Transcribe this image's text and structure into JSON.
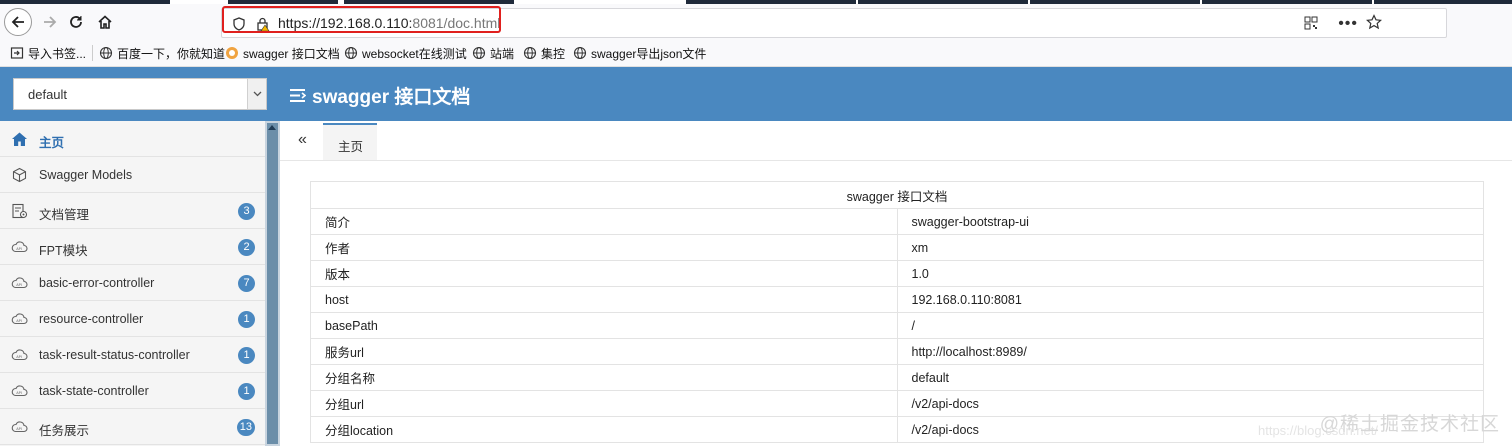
{
  "browser": {
    "url_host": "https://192.168.0.110:",
    "url_rest": "8081/doc.html",
    "bookmarks": [
      {
        "label": "导入书签...",
        "icon": "import-icon"
      },
      {
        "label": "百度一下，你就知道",
        "icon": "globe-icon"
      },
      {
        "label": "swagger 接口文档",
        "icon": "swagger-icon"
      },
      {
        "label": "websocket在线测试",
        "icon": "globe-icon"
      },
      {
        "label": "站端",
        "icon": "globe-icon"
      },
      {
        "label": "集控",
        "icon": "globe-icon"
      },
      {
        "label": "swagger导出json文件",
        "icon": "globe-icon"
      }
    ]
  },
  "header": {
    "group_select_value": "default",
    "title": "swagger 接口文档"
  },
  "sidebar": {
    "items": [
      {
        "label": "主页",
        "icon": "home-icon",
        "active": true,
        "badge": ""
      },
      {
        "label": "Swagger Models",
        "icon": "cube-icon",
        "badge": ""
      },
      {
        "label": "文档管理",
        "icon": "doc-settings-icon",
        "badge": "3"
      },
      {
        "label": "FPT模块",
        "icon": "cloud-api-icon",
        "badge": "2"
      },
      {
        "label": "basic-error-controller",
        "icon": "cloud-api-icon",
        "badge": "7"
      },
      {
        "label": "resource-controller",
        "icon": "cloud-api-icon",
        "badge": "1"
      },
      {
        "label": "task-result-status-controller",
        "icon": "cloud-api-icon",
        "badge": "1"
      },
      {
        "label": "task-state-controller",
        "icon": "cloud-api-icon",
        "badge": "1"
      },
      {
        "label": "任务展示",
        "icon": "cloud-api-icon",
        "badge": "13"
      }
    ]
  },
  "tabs": {
    "collapse_symbol": "«",
    "home": "主页"
  },
  "info": {
    "title": "swagger 接口文档",
    "rows": [
      {
        "key": "简介",
        "value": "swagger-bootstrap-ui"
      },
      {
        "key": "作者",
        "value": "xm"
      },
      {
        "key": "版本",
        "value": "1.0"
      },
      {
        "key": "host",
        "value": "192.168.0.110:8081"
      },
      {
        "key": "basePath",
        "value": "/"
      },
      {
        "key": "服务url",
        "value": "http://localhost:8989/"
      },
      {
        "key": "分组名称",
        "value": "default"
      },
      {
        "key": "分组url",
        "value": "/v2/api-docs"
      },
      {
        "key": "分组location",
        "value": "/v2/api-docs"
      }
    ]
  },
  "watermark": {
    "text": "@稀土掘金技术社区",
    "url": "https://blog.csdn.net/"
  },
  "colors": {
    "header": "#4a88c0",
    "badge": "#4a88c0",
    "highlight": "#e0201e"
  }
}
